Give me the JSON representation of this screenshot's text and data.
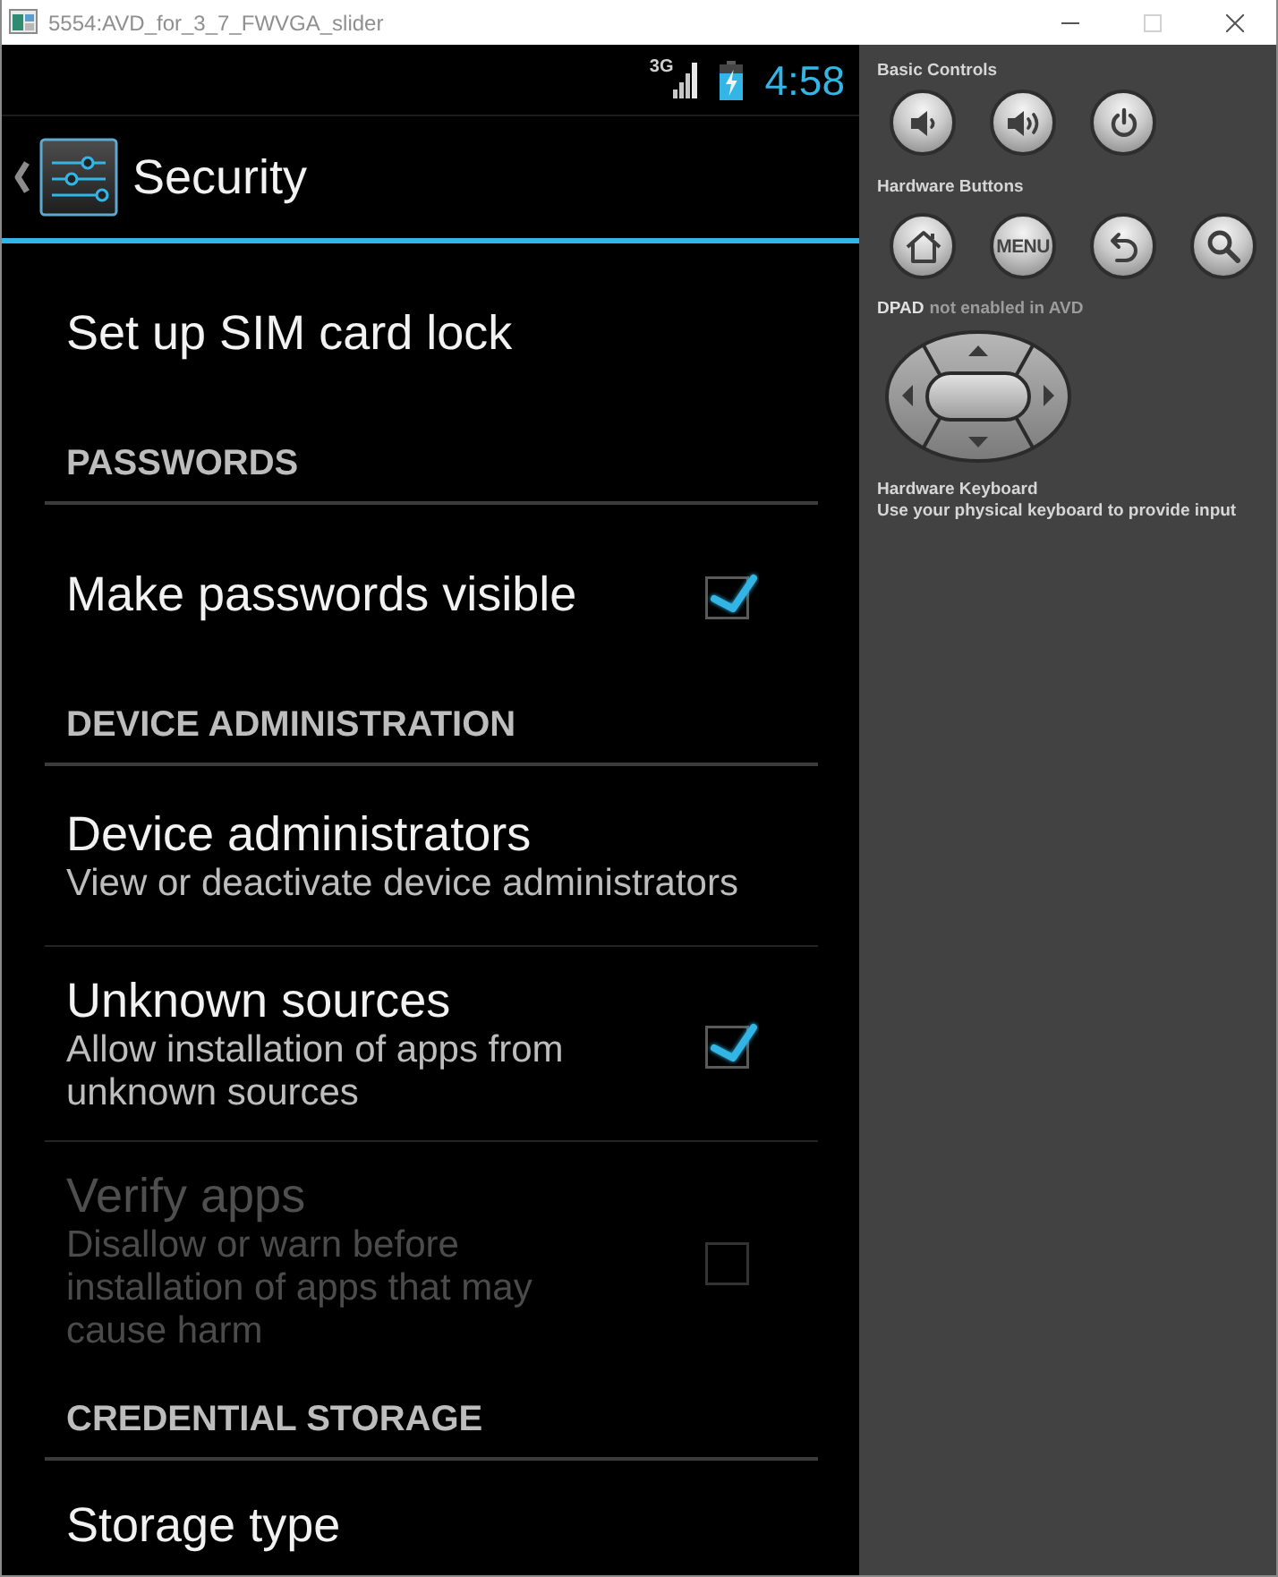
{
  "window": {
    "title": "5554:AVD_for_3_7_FWVGA_slider",
    "controls": [
      {
        "kind": "minimize",
        "disabled": false
      },
      {
        "kind": "maximize",
        "disabled": true
      },
      {
        "kind": "close",
        "disabled": false
      }
    ]
  },
  "status_bar": {
    "network_type": "3G",
    "time": "4:58"
  },
  "action_bar": {
    "title": "Security"
  },
  "sections": [
    {
      "items": [
        {
          "kind": "plain",
          "title": "Set up SIM card lock",
          "disabled": false
        }
      ]
    },
    {
      "header": "PASSWORDS",
      "items": [
        {
          "kind": "checkbox",
          "title": "Make passwords visible",
          "checked": true,
          "disabled": false
        }
      ]
    },
    {
      "header": "DEVICE ADMINISTRATION",
      "items": [
        {
          "kind": "plain",
          "title": "Device administrators",
          "summary": "View or deactivate device administrators",
          "disabled": false
        },
        {
          "kind": "checkbox",
          "title": "Unknown sources",
          "summary": "Allow installation of apps from unknown sources",
          "checked": true,
          "disabled": false
        },
        {
          "kind": "checkbox",
          "title": "Verify apps",
          "summary": "Disallow or warn before installation of apps that may cause harm",
          "checked": false,
          "disabled": true
        }
      ]
    },
    {
      "header": "CREDENTIAL STORAGE",
      "items": [
        {
          "kind": "plain",
          "title": "Storage type",
          "disabled": false
        }
      ]
    }
  ],
  "emulator_panel": {
    "basic_controls": {
      "label": "Basic Controls",
      "buttons": [
        {
          "kind": "volume_down"
        },
        {
          "kind": "volume_up"
        },
        {
          "kind": "power"
        }
      ]
    },
    "hardware_buttons": {
      "label": "Hardware Buttons",
      "buttons": [
        {
          "kind": "home"
        },
        {
          "kind": "text",
          "label": "MENU"
        },
        {
          "kind": "back"
        },
        {
          "kind": "search"
        }
      ]
    },
    "dpad": {
      "label": "DPAD",
      "note": "not enabled in AVD"
    },
    "keyboard": {
      "title": "Hardware Keyboard",
      "description": "Use your physical keyboard to provide input"
    }
  }
}
